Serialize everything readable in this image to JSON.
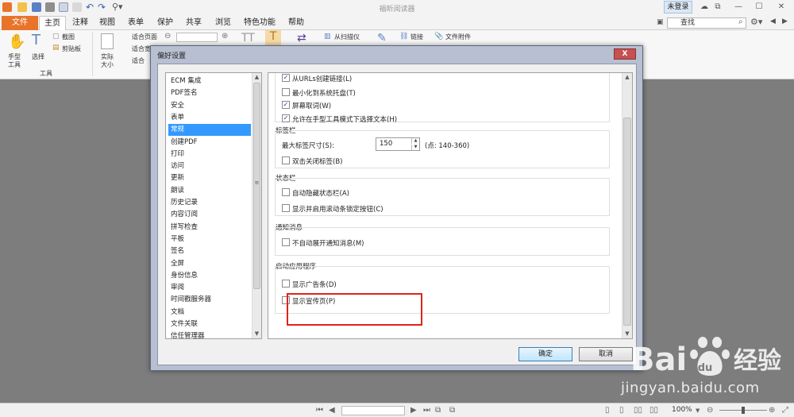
{
  "app": {
    "title": "福昕阅读器",
    "login": "未登录",
    "search_placeholder": "查找"
  },
  "menu": {
    "tabs": [
      "文件",
      "主页",
      "注释",
      "视图",
      "表单",
      "保护",
      "共享",
      "浏览",
      "特色功能",
      "帮助"
    ]
  },
  "ribbon": {
    "hand_tool": "手型\n工具",
    "hand_tool_l1": "手型",
    "hand_tool_l2": "工具",
    "select": "选择",
    "screenshot": "截图",
    "clipboard": "剪贴板",
    "tools_group": "工具",
    "actual_size_l1": "实际",
    "actual_size_l2": "大小",
    "fit_page": "适合页面",
    "fit_width": "适合宽度",
    "fit_visible": "适合",
    "from_scanner": "从扫描仪",
    "link": "链接",
    "file_attachment": "文件附件"
  },
  "dialog": {
    "title": "偏好设置",
    "close": "X",
    "categories": [
      "ECM 集成",
      "PDF签名",
      "安全",
      "表单",
      "常规",
      "创建PDF",
      "打印",
      "访问",
      "更新",
      "朗读",
      "历史记录",
      "内容订阅",
      "拼写检查",
      "平板",
      "签名",
      "全屏",
      "身份信息",
      "审阅",
      "时间戳服务器",
      "文档",
      "文件关联",
      "信任管理器"
    ],
    "selected_category": "常规",
    "groups": {
      "general": {
        "items": [
          {
            "label": "从URLs创建链接(L)",
            "checked": true
          },
          {
            "label": "最小化到系统托盘(T)",
            "checked": false
          },
          {
            "label": "屏幕取词(W)",
            "checked": true
          },
          {
            "label": "允许在手型工具模式下选择文本(H)",
            "checked": true
          }
        ]
      },
      "tabs": {
        "title": "标签栏",
        "max_size_label": "最大标签尺寸(S):",
        "max_size_value": "150",
        "range": "(点: 140-360)",
        "double_click_close": "双击关闭标签(B)"
      },
      "statusbar": {
        "title": "状态栏",
        "auto_hide": "自动隐藏状态栏(A)",
        "show_scroll_lock": "显示并启用滚动条锁定按钮(C)"
      },
      "notification": {
        "title": "通知消息",
        "no_auto_expand": "不自动展开通知消息(M)"
      },
      "launch": {
        "title": "启动应用程序",
        "show_ad_bar": "显示广告条(D)",
        "show_promo_page": "显示宣传页(P)"
      }
    },
    "ok": "确定",
    "cancel": "取消"
  },
  "statusbar": {
    "zoom": "100%"
  },
  "watermark": {
    "brand": "Bai du 经验",
    "url": "jingyan.baidu.com"
  },
  "colors": {
    "file_tab": "#e8742a",
    "selected": "#3399ff",
    "highlight": "#e0241b"
  }
}
